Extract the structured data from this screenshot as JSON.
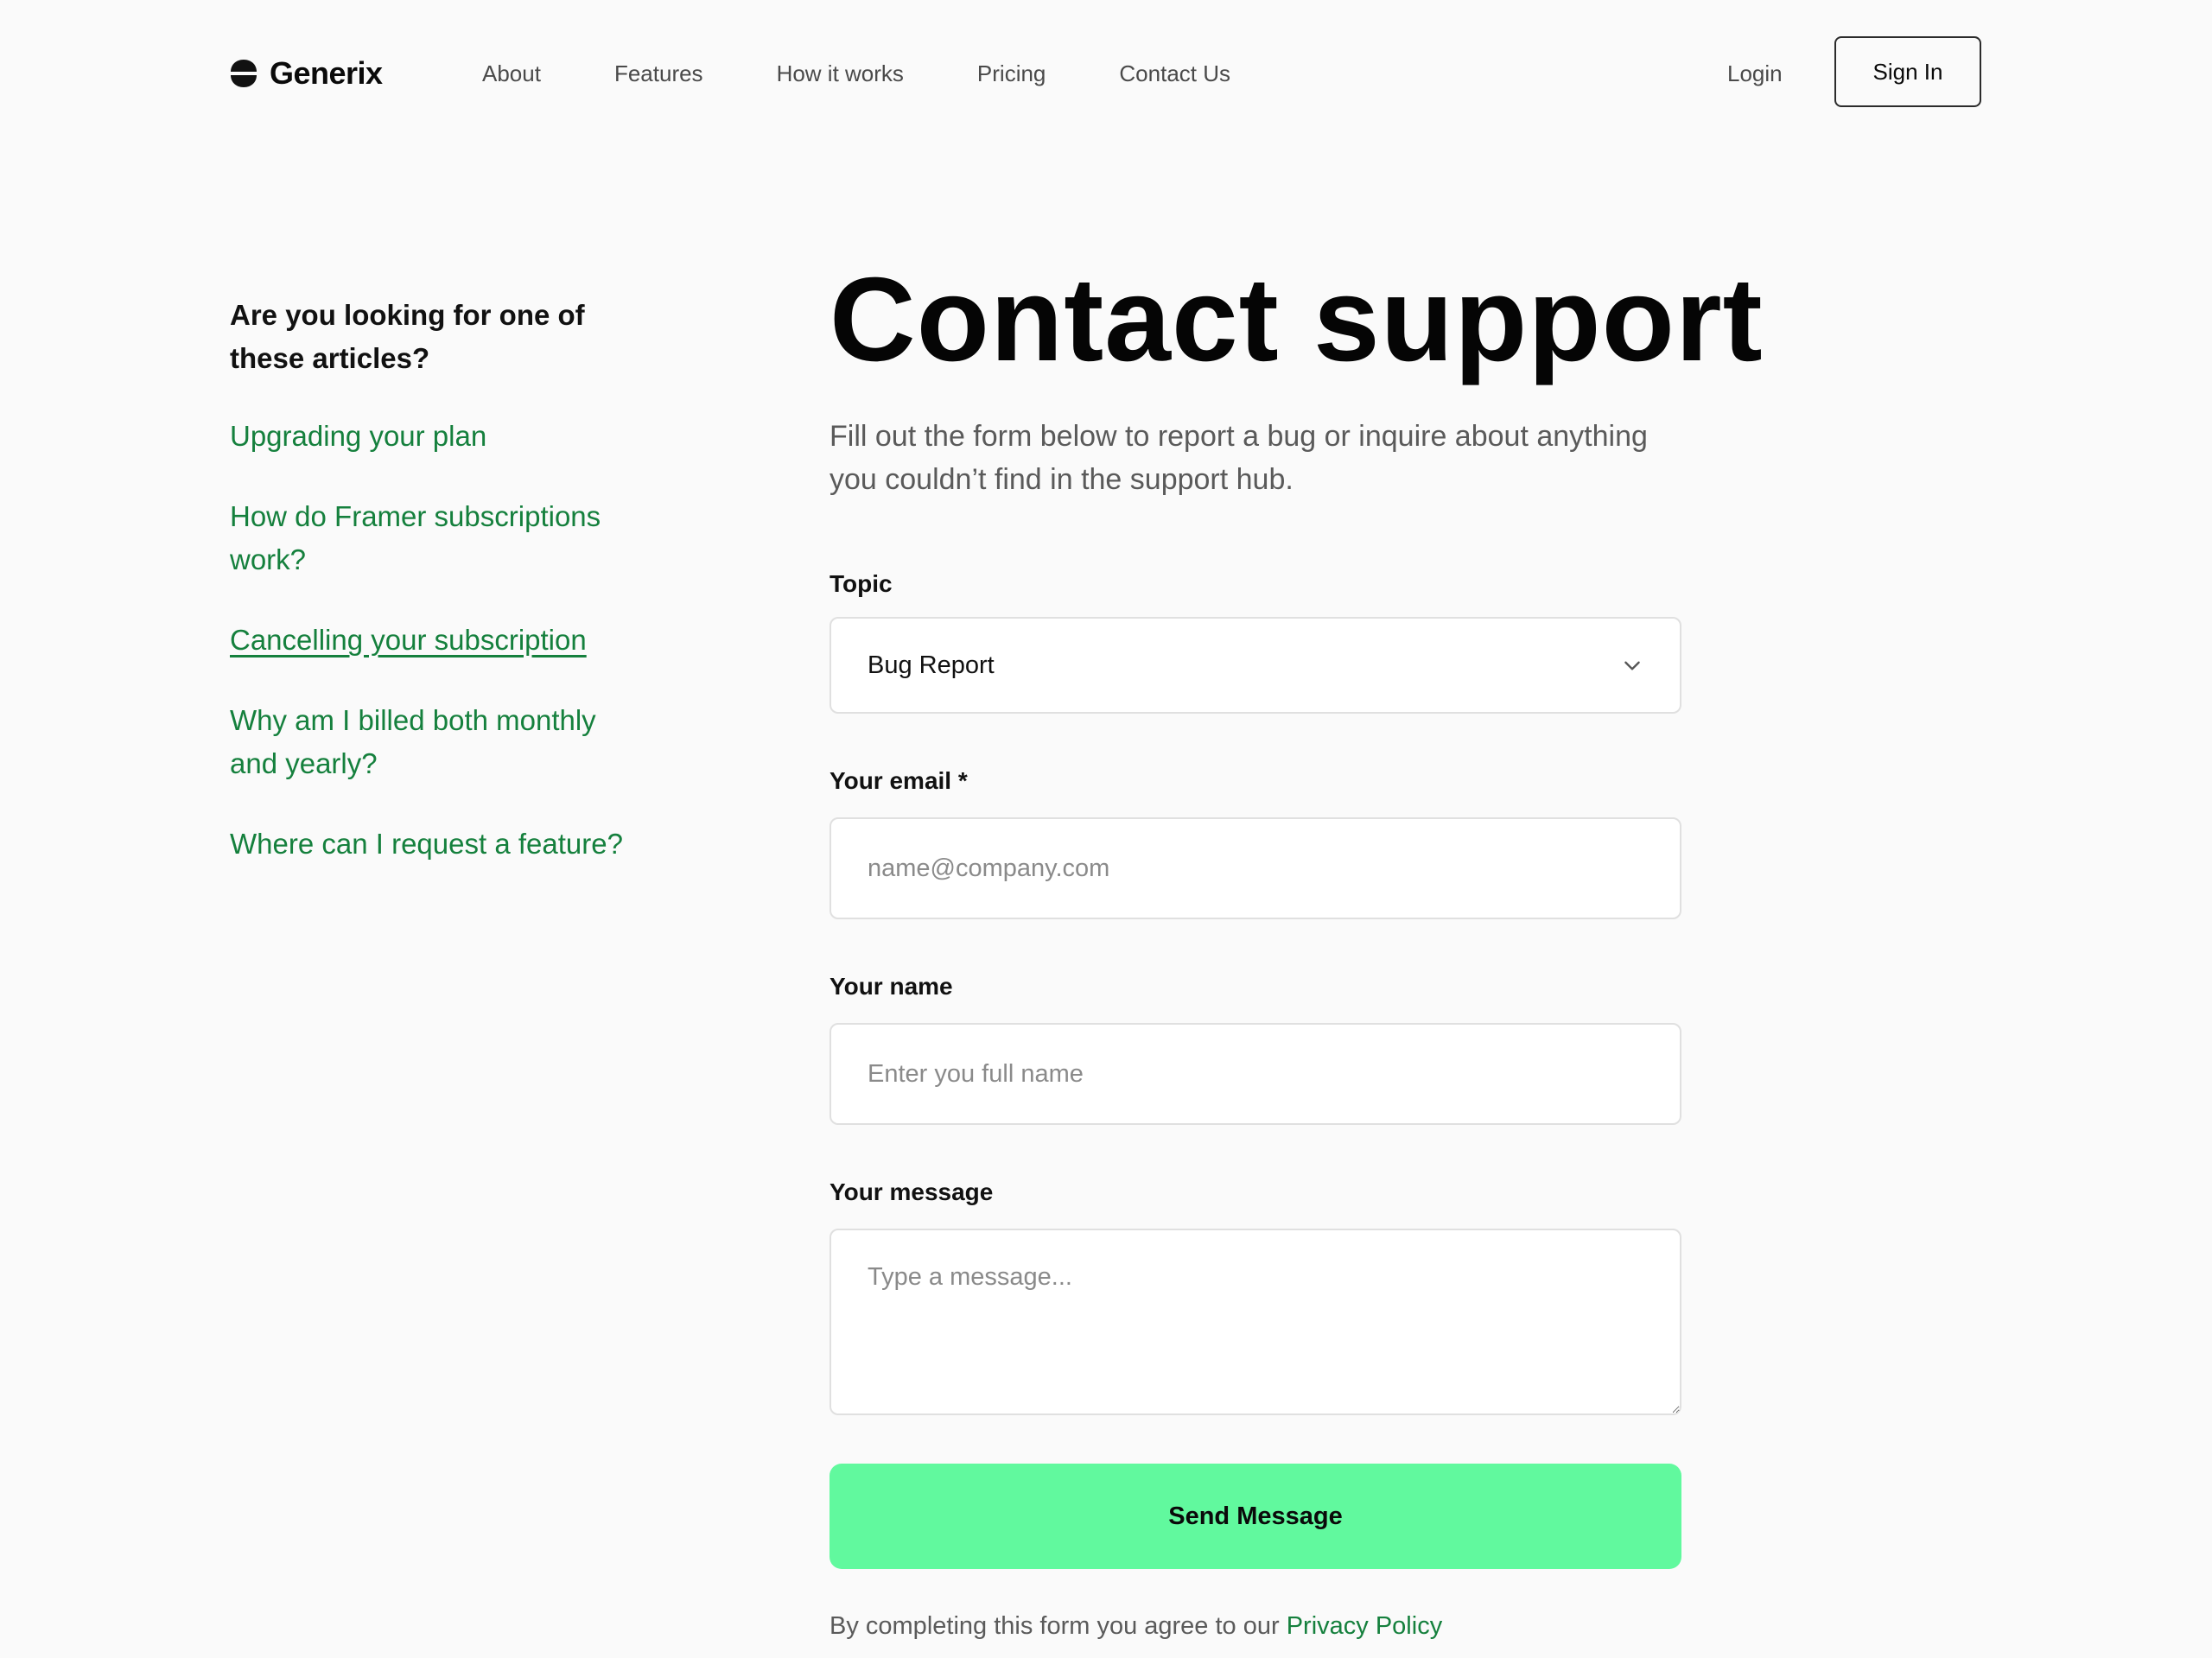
{
  "brand": {
    "name": "Generix",
    "icon": "logo-mark-icon"
  },
  "nav": {
    "items": [
      {
        "label": "About"
      },
      {
        "label": "Features"
      },
      {
        "label": "How it works"
      },
      {
        "label": "Pricing"
      },
      {
        "label": "Contact Us"
      }
    ],
    "login_label": "Login",
    "signin_label": "Sign In"
  },
  "sidebar": {
    "title": "Are you looking for one of these articles?",
    "articles": [
      {
        "label": "Upgrading your plan"
      },
      {
        "label": "How do Framer subscriptions work?"
      },
      {
        "label": "Cancelling your subscription"
      },
      {
        "label": "Why am I billed both monthly and yearly?"
      },
      {
        "label": "Where can I request a feature?"
      }
    ]
  },
  "main": {
    "title": "Contact support",
    "subtitle": "Fill out the form below to report a bug or inquire about anything you couldn’t find in the support hub.",
    "form": {
      "topic_label": "Topic",
      "topic_value": "Bug Report",
      "email_label": "Your email *",
      "email_placeholder": "name@company.com",
      "name_label": "Your name",
      "name_placeholder": "Enter you full name",
      "message_label": "Your message",
      "message_placeholder": "Type a message...",
      "submit_label": "Send Message"
    },
    "privacy_prefix": "By completing this form you agree to our",
    "privacy_link": "Privacy Policy"
  },
  "colors": {
    "background": "#fafafa",
    "accent_green": "#61f99e",
    "link_green": "#15803d",
    "text_dark": "#0a0a0a",
    "text_muted": "#5a5a5a",
    "border": "#e0e0e0"
  }
}
